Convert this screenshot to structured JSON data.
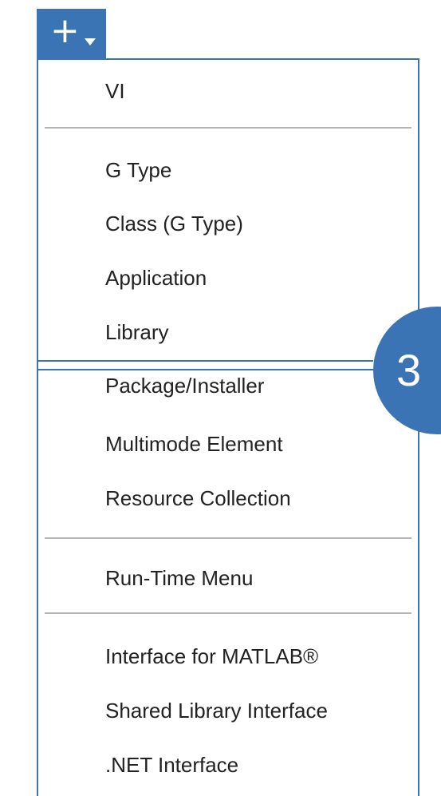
{
  "add_button": {
    "plus_glyph": "+",
    "icon": "chevron-down-icon"
  },
  "menu": {
    "items": [
      {
        "label": "VI"
      },
      {
        "label": "G Type"
      },
      {
        "label": "Class (G Type)"
      },
      {
        "label": "Application"
      },
      {
        "label": "Library"
      },
      {
        "label": "Package/Installer"
      },
      {
        "label": "Multimode Element"
      },
      {
        "label": "Resource Collection"
      },
      {
        "label": "Run-Time Menu"
      },
      {
        "label": "Interface for MATLAB®"
      },
      {
        "label": "Shared Library Interface"
      },
      {
        "label": ".NET Interface"
      }
    ],
    "highlighted_item": "Package/Installer"
  },
  "callout": {
    "number": "3"
  },
  "colors": {
    "accent": "#3a74b4",
    "separator": "#b5b5b5",
    "text": "#222222"
  }
}
